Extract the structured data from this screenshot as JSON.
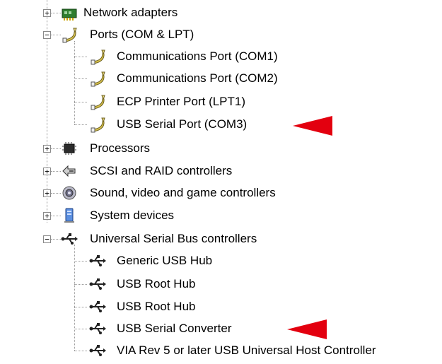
{
  "window": {
    "title": ""
  },
  "tree": {
    "network_adapters": {
      "label": "Network adapters",
      "expander": "+"
    },
    "ports": {
      "label": "Ports (COM & LPT)",
      "expander": "−",
      "children": [
        {
          "label": "Communications Port (COM1)"
        },
        {
          "label": "Communications Port (COM2)"
        },
        {
          "label": "ECP Printer Port (LPT1)"
        },
        {
          "label": "USB Serial Port (COM3)"
        }
      ]
    },
    "processors": {
      "label": "Processors",
      "expander": "+"
    },
    "scsi": {
      "label": "SCSI and RAID controllers",
      "expander": "+"
    },
    "sound": {
      "label": "Sound, video and game controllers",
      "expander": "+"
    },
    "system": {
      "label": "System devices",
      "expander": "+"
    },
    "usb": {
      "label": "Universal Serial Bus controllers",
      "expander": "−",
      "children": [
        {
          "label": "Generic USB Hub"
        },
        {
          "label": "USB Root Hub"
        },
        {
          "label": "USB Root Hub"
        },
        {
          "label": "USB Serial Converter"
        },
        {
          "label": "VIA Rev 5 or later USB Universal Host Controller"
        }
      ]
    }
  },
  "annotations": {
    "arrow_color": "#e3000f"
  },
  "icons": {
    "network": "network-card-icon",
    "port": "serial-port-icon",
    "processor": "chip-icon",
    "scsi": "scsi-icon",
    "sound": "speaker-icon",
    "system": "computer-icon",
    "usb": "usb-icon"
  }
}
